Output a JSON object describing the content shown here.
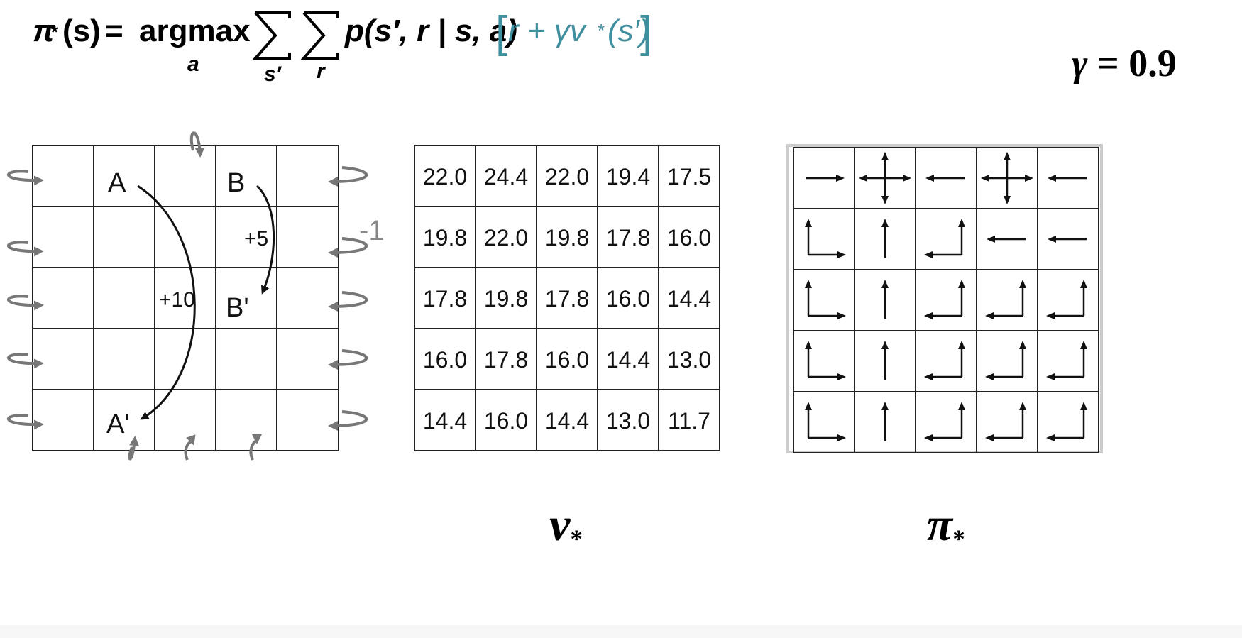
{
  "formula": {
    "lhs_pi": "π",
    "lhs_star": "*",
    "lhs_arg": "(s)",
    "equals": "=",
    "argmax": "argmax",
    "argmax_sub": "a",
    "sum1_sub": "s′",
    "sum2_sub": "r",
    "prob": "p(s′, r | s, a)",
    "bracket_open": "[",
    "bracket_content": "r + γv",
    "bracket_star": "*",
    "bracket_arg": "(s′)",
    "bracket_close": "]"
  },
  "gamma": {
    "symbol": "γ",
    "text": " = 0.9"
  },
  "gridworld": {
    "labels": {
      "A": "A",
      "B": "B",
      "A_prime": "A'",
      "B_prime": "B'",
      "reward_a": "+10",
      "reward_b": "+5",
      "edge_penalty": "-1"
    }
  },
  "value_table": {
    "rows": [
      [
        "22.0",
        "24.4",
        "22.0",
        "19.4",
        "17.5"
      ],
      [
        "19.8",
        "22.0",
        "19.8",
        "17.8",
        "16.0"
      ],
      [
        "17.8",
        "19.8",
        "17.8",
        "16.0",
        "14.4"
      ],
      [
        "16.0",
        "17.8",
        "16.0",
        "14.4",
        "13.0"
      ],
      [
        "14.4",
        "16.0",
        "14.4",
        "13.0",
        "11.7"
      ]
    ],
    "label_main": "v",
    "label_sub": "*"
  },
  "policy_table": {
    "rows": [
      [
        "right",
        "all",
        "left",
        "all",
        "left"
      ],
      [
        "up-right",
        "up",
        "up-left",
        "left",
        "left"
      ],
      [
        "up-right",
        "up",
        "up-left",
        "up-left",
        "up-left"
      ],
      [
        "up-right",
        "up",
        "up-left",
        "up-left",
        "up-left"
      ],
      [
        "up-right",
        "up",
        "up-left",
        "up-left",
        "up-left"
      ]
    ],
    "label_main": "π",
    "label_sub": "*"
  },
  "colors": {
    "teal": "#3f8f9f",
    "grid_line": "#222222",
    "wall_arrow": "#777777"
  }
}
